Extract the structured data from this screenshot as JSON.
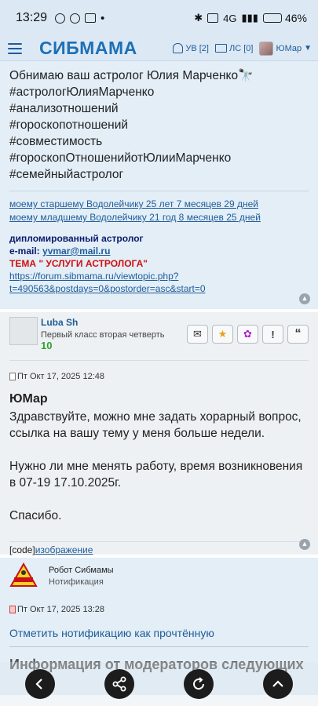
{
  "status_bar": {
    "time": "13:29",
    "network": "4G",
    "battery_percent_label": "46%",
    "battery_level": 0.46
  },
  "header": {
    "logo": "СИБМАМА",
    "notifications_label": "УВ [2]",
    "messages_label": "ЛС [0]",
    "username": "ЮМар"
  },
  "post1": {
    "signature_lines": [
      "Обнимаю ваш астролог Юлия Марченко🔭",
      "#астрологЮлияМарченко",
      "#анализотношений",
      "#гороскопотношений",
      "#совместимость",
      "#гороскопОтношенийотЮлииМарченко",
      "#семейныйастролог"
    ],
    "son_links": [
      "моему старшему Водолейчику 25 лет 7 месяцев 29 дней",
      "моему младшему Водолейчику 21 год 8 месяцев 25 дней"
    ],
    "astrologer_title": "дипломированный астролог",
    "email_label": "e-mail: ",
    "email": "yvmar@mail.ru",
    "topic_label": "ТЕМА \" УСЛУГИ АСТРОЛОГА\"",
    "topic_url_line1": "https://forum.sibmama.ru/viewtopic.php?",
    "topic_url_line2": "t=490563&postdays=0&postorder=asc&start=0"
  },
  "post2": {
    "author": "Luba Sh",
    "rank": "Первый класс вторая четверть",
    "rank_number": "10",
    "date": "Пт Окт 17, 2025 12:48",
    "quote_author": "ЮМар",
    "body_lines": [
      "Здравствуйте, можно мне задать хорарный вопрос, ссылка на вашу тему у меня больше недели.",
      "Нужно ли мне менять работу, время возникновения в 07-19 17.10.2025г.",
      "Спасибо."
    ],
    "code_label": "[code]",
    "image_link": "изображение"
  },
  "post3": {
    "author": "Робот Сибмамы",
    "rank": "Нотификация",
    "date": "Пт Окт 17, 2025 13:28",
    "mark_read": "Отметить нотификацию как прочтённую",
    "heading": "Информация от модераторов следующих"
  }
}
